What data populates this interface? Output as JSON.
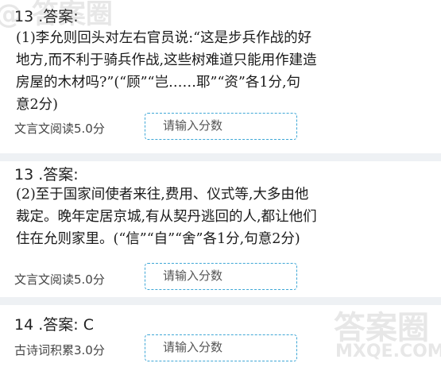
{
  "questions": [
    {
      "title": "13 .答案:",
      "answer": "(1)李允则回头对左右官员说:“这是步兵作战的好\n地方,而不利于骑兵作战,这些树难道只能用作建造\n房屋的木材吗?”(“顾”“岂……耶”“资”各1分,句\n意2分)",
      "score_label": "文言文阅读5.0分",
      "input_placeholder": "请输入分数"
    },
    {
      "title": "13 .答案:",
      "answer": "(2)至于国家间使者来往,费用、仪式等,大多由他\n裁定。晚年定居京城,有从契丹逃回的人,都让他们\n住在允则家里。(“信”“自”“舍”各1分,句意2分)",
      "score_label": "文言文阅读5.0分",
      "input_placeholder": "请输入分数"
    },
    {
      "title": "14 .答案: C",
      "score_label": "古诗词积累3.0分",
      "input_placeholder": "请输入分数"
    }
  ],
  "watermark": {
    "top_left": "@ 答案圈",
    "bottom_right_line1": "答案圈",
    "bottom_right_line2": "MXQE.COM"
  },
  "colors": {
    "input_border": "#3fa7d6",
    "separator": "#eef1f4"
  }
}
